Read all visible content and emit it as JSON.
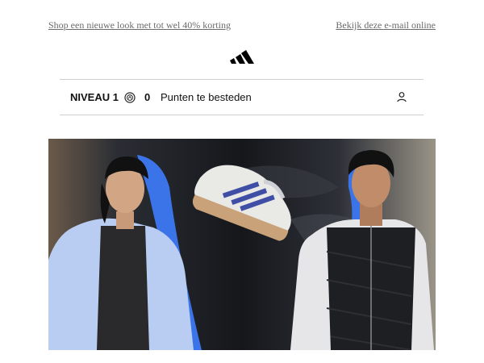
{
  "header": {
    "promo_link": "Shop een nieuwe look met tot wel 40% korting",
    "view_online_link": "Bekijk deze e-mail online"
  },
  "brand": {
    "logo": "adidas-logo-icon"
  },
  "loyalty": {
    "level": "NIVEAU 1",
    "coin_icon": "points-coin-icon",
    "points": "0",
    "points_label": "Punten te besteden",
    "account_icon": "user-icon"
  },
  "hero": {
    "description_icon": "hero-banner-image",
    "colors": {
      "blue_accent": "#3b74e8",
      "dark_bg": "#16181c",
      "jacket": "#b9ccf2",
      "shoe_stripes": "#3f4fa6",
      "sole": "#c9a27a"
    }
  }
}
